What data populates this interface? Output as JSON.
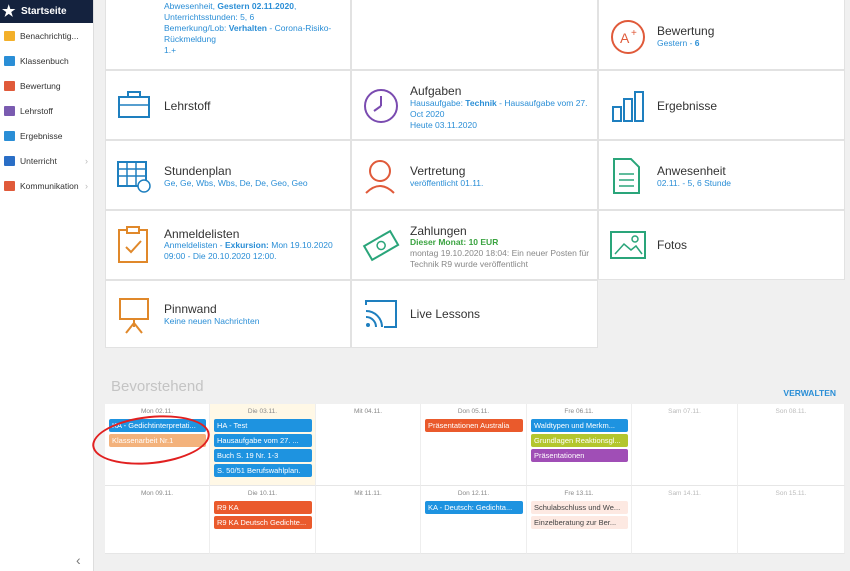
{
  "sidebar": {
    "active": "Startseite",
    "items": [
      {
        "label": "Benachrichtig...",
        "icon": "envelope-icon",
        "color": "#f3b02a"
      },
      {
        "label": "Klassenbuch",
        "icon": "book-icon",
        "color": "#2a8ed6"
      },
      {
        "label": "Bewertung",
        "icon": "grade-icon",
        "color": "#e05a3a"
      },
      {
        "label": "Lehrstoff",
        "icon": "briefcase-icon",
        "color": "#7a5bb0"
      },
      {
        "label": "Ergebnisse",
        "icon": "bar-chart-icon",
        "color": "#2a8ed6"
      },
      {
        "label": "Unterricht",
        "icon": "calendar-icon",
        "color": "#2a6ec6"
      },
      {
        "label": "Kommunikation",
        "icon": "chat-icon",
        "color": "#e05a3a"
      }
    ]
  },
  "tiles": {
    "top_left": {
      "line1_pre": "Abwesenheit, ",
      "line1_bold": "Gestern 02.11.2020",
      "line1_post": ", Unterrichtsstunden: 5, 6",
      "line2_pre": "Bemerkung/Lob: ",
      "line2_bold": "Verhalten",
      "line2_post": " - Corona-Risiko-Rückmeldung",
      "line3": "1.+"
    },
    "bewertung": {
      "title": "Bewertung",
      "sub_pre": "Gestern - ",
      "sub_bold": "6"
    },
    "lehrstoff": {
      "title": "Lehrstoff"
    },
    "aufgaben": {
      "title": "Aufgaben",
      "sub1_pre": "Hausaufgabe: ",
      "sub1_bold": "Technik",
      "sub1_post": " - Hausaufgabe vom 27. Oct 2020",
      "sub2": "Heute 03.11.2020"
    },
    "ergebnisse": {
      "title": "Ergebnisse"
    },
    "stundenplan": {
      "title": "Stundenplan",
      "sub": "Ge, Ge, Wbs, Wbs, De, De, Geo, Geo"
    },
    "vertretung": {
      "title": "Vertretung",
      "sub": "veröffentlicht 01.11."
    },
    "anwesenheit": {
      "title": "Anwesenheit",
      "sub": "02.11. - 5, 6 Stunde"
    },
    "anmeldelisten": {
      "title": "Anmeldelisten",
      "sub_pre": "Anmeldelisten - ",
      "sub_bold": "Exkursion:",
      "sub_post": " Mon 19.10.2020 09:00 - Die 20.10.2020 12:00."
    },
    "zahlungen": {
      "title": "Zahlungen",
      "sub1": "Dieser Monat: 10 EUR",
      "sub2": "montag 19.10.2020 18:04: Ein neuer Posten für Technik R9 wurde veröffentlicht"
    },
    "fotos": {
      "title": "Fotos"
    },
    "pinnwand": {
      "title": "Pinnwand",
      "sub": "Keine neuen Nachrichten"
    },
    "live": {
      "title": "Live Lessons"
    }
  },
  "upcoming": {
    "title": "Bevorstehend",
    "manage": "VERWALTEN",
    "week1": [
      {
        "day": "Mon 02.11.",
        "events": [
          {
            "t": "KA - Gedichtinterpretati...",
            "c": "blue"
          },
          {
            "t": "Klassenarbeit Nr.1",
            "c": "orange"
          }
        ]
      },
      {
        "day": "Die 03.11.",
        "today": true,
        "events": [
          {
            "t": "HA - Test",
            "c": "blue"
          },
          {
            "t": "Hausaufgabe vom 27. ...",
            "c": "blue"
          },
          {
            "t": "Buch S. 19 Nr. 1-3",
            "c": "blue"
          },
          {
            "t": "S. 50/51 Berufswahlplan.",
            "c": "blue"
          }
        ]
      },
      {
        "day": "Mit 04.11.",
        "events": []
      },
      {
        "day": "Don 05.11.",
        "events": [
          {
            "t": "Präsentationen Australia",
            "c": "red"
          }
        ]
      },
      {
        "day": "Fre 06.11.",
        "events": [
          {
            "t": "Waldtypen und Merkm...",
            "c": "blue"
          },
          {
            "t": "Grundlagen Reaktionsgl...",
            "c": "olive"
          },
          {
            "t": "Präsentationen",
            "c": "purple"
          }
        ]
      },
      {
        "day": "Sam 07.11.",
        "weekend": true,
        "events": []
      },
      {
        "day": "Son 08.11.",
        "weekend": true,
        "events": []
      }
    ],
    "week2": [
      {
        "day": "Mon 09.11.",
        "events": []
      },
      {
        "day": "Die 10.11.",
        "events": [
          {
            "t": "R9 KA",
            "c": "red"
          },
          {
            "t": "R9 KA Deutsch Gedichte...",
            "c": "red"
          }
        ]
      },
      {
        "day": "Mit 11.11.",
        "events": []
      },
      {
        "day": "Don 12.11.",
        "events": [
          {
            "t": "KA - Deutsch: Gedichta...",
            "c": "blue"
          }
        ]
      },
      {
        "day": "Fre 13.11.",
        "events": [
          {
            "t": "Schulabschluss und We...",
            "c": "light"
          },
          {
            "t": "Einzelberatung zur Ber...",
            "c": "light"
          }
        ]
      },
      {
        "day": "Sam 14.11.",
        "weekend": true,
        "events": []
      },
      {
        "day": "Son 15.11.",
        "weekend": true,
        "events": []
      }
    ]
  }
}
